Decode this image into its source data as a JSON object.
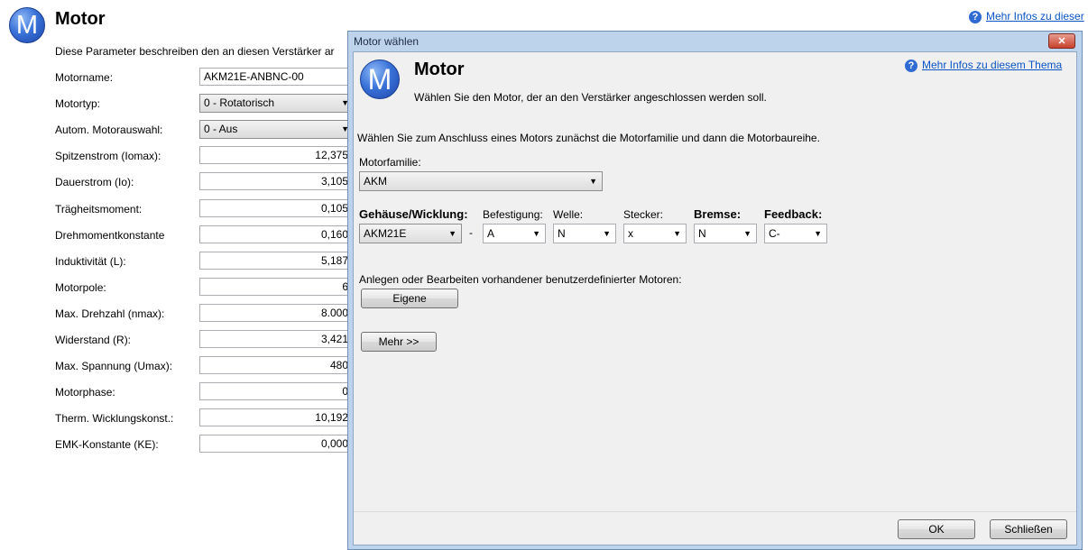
{
  "background": {
    "title": "Motor",
    "description": "Diese Parameter beschreiben den an diesen Verstärker ar",
    "help_link": "Mehr Infos zu dieser",
    "params": [
      {
        "label": "Motorname:",
        "value": "AKM21E-ANBNC-00",
        "kind": "text"
      },
      {
        "label": "Motortyp:",
        "value": "0 - Rotatorisch",
        "kind": "select"
      },
      {
        "label": "Autom. Motorauswahl:",
        "value": "0 - Aus",
        "kind": "select"
      },
      {
        "label": "Spitzenstrom (Iomax):",
        "value": "12,375",
        "kind": "num"
      },
      {
        "label": "Dauerstrom (Io):",
        "value": "3,105",
        "kind": "num"
      },
      {
        "label": "Trägheitsmoment:",
        "value": "0,105",
        "kind": "num"
      },
      {
        "label": "Drehmomentkonstante",
        "value": "0,160",
        "kind": "num"
      },
      {
        "label": "Induktivität (L):",
        "value": "5,187",
        "kind": "num"
      },
      {
        "label": "Motorpole:",
        "value": "6",
        "kind": "num"
      },
      {
        "label": "Max. Drehzahl (nmax):",
        "value": "8.000",
        "kind": "num"
      },
      {
        "label": "Widerstand (R):",
        "value": "3,421",
        "kind": "num"
      },
      {
        "label": "Max. Spannung (Umax):",
        "value": "480",
        "kind": "num"
      },
      {
        "label": "Motorphase:",
        "value": "0",
        "kind": "num"
      },
      {
        "label": "Therm. Wicklungskonst.:",
        "value": "10,192",
        "kind": "num"
      },
      {
        "label": "EMK-Konstante (KE):",
        "value": "0,000",
        "kind": "num"
      }
    ]
  },
  "dialog": {
    "title": "Motor wählen",
    "close_label": "✕",
    "heading": "Motor",
    "subheading": "Wählen Sie den Motor, der an den Verstärker angeschlossen werden soll.",
    "help_link": "Mehr Infos zu diesem Thema",
    "instruction": "Wählen Sie zum Anschluss eines Motors zunächst die Motorfamilie und dann die Motorbaureihe.",
    "family_label": "Motorfamilie:",
    "family_value": "AKM",
    "columns": {
      "housing": {
        "label": "Gehäuse/Wicklung:",
        "value": "AKM21E"
      },
      "separator": "-",
      "mounting": {
        "label": "Befestigung:",
        "value": "A"
      },
      "shaft": {
        "label": "Welle:",
        "value": "N"
      },
      "connector": {
        "label": "Stecker:",
        "value": "x"
      },
      "brake": {
        "label": "Bremse:",
        "value": "N"
      },
      "feedback": {
        "label": "Feedback:",
        "value": "C-"
      }
    },
    "custom_label": "Anlegen oder Bearbeiten vorhandener benutzerdefinierter Motoren:",
    "custom_button": "Eigene",
    "more_button": "Mehr >>",
    "ok_button": "OK",
    "close_button": "Schließen"
  },
  "icons": {
    "logo": "M",
    "help": "?",
    "dropdown": "▼"
  }
}
